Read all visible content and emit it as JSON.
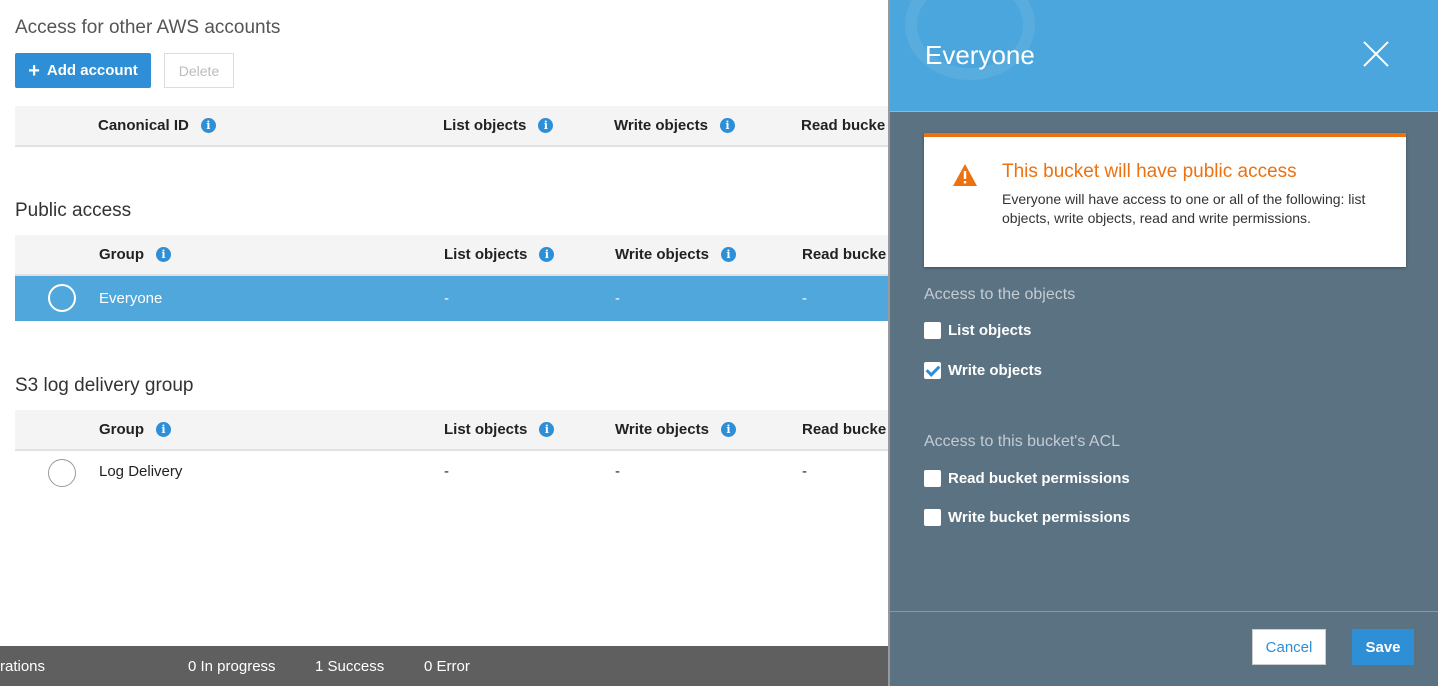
{
  "aws_accounts": {
    "title": "Access for other AWS accounts",
    "add_label": "Add account",
    "delete_label": "Delete",
    "columns": [
      "Canonical ID",
      "List objects",
      "Write objects",
      "Read bucke"
    ]
  },
  "public_access": {
    "title": "Public access",
    "columns": [
      "Group",
      "List objects",
      "Write objects",
      "Read bucke"
    ],
    "row": {
      "group": "Everyone",
      "list": "-",
      "write": "-",
      "read": "-"
    }
  },
  "s3_log": {
    "title": "S3 log delivery group",
    "columns": [
      "Group",
      "List objects",
      "Write objects",
      "Read bucke"
    ],
    "row": {
      "group": "Log Delivery",
      "list": "-",
      "write": "-",
      "read": "-"
    }
  },
  "footer": {
    "operations": "rations",
    "in_progress": "0 In progress",
    "success": "1 Success",
    "error": "0 Error"
  },
  "panel": {
    "title": "Everyone",
    "alert": {
      "title": "This bucket will have public access",
      "body": "Everyone will have access to one or all of the following: list objects, write objects, read and write permissions."
    },
    "objects_group": "Access to the objects",
    "list_objects": "List objects",
    "write_objects": "Write objects",
    "acl_group": "Access to this bucket's ACL",
    "read_perms": "Read bucket permissions",
    "write_perms": "Write bucket permissions",
    "cancel": "Cancel",
    "save": "Save",
    "checked": {
      "list_objects": false,
      "write_objects": true,
      "read_perms": false,
      "write_perms": false
    }
  },
  "colors": {
    "accent": "#2e8ed6",
    "selected_row": "#4fa7dc",
    "warning": "#ec7211",
    "panel_bg": "#5b7282"
  }
}
